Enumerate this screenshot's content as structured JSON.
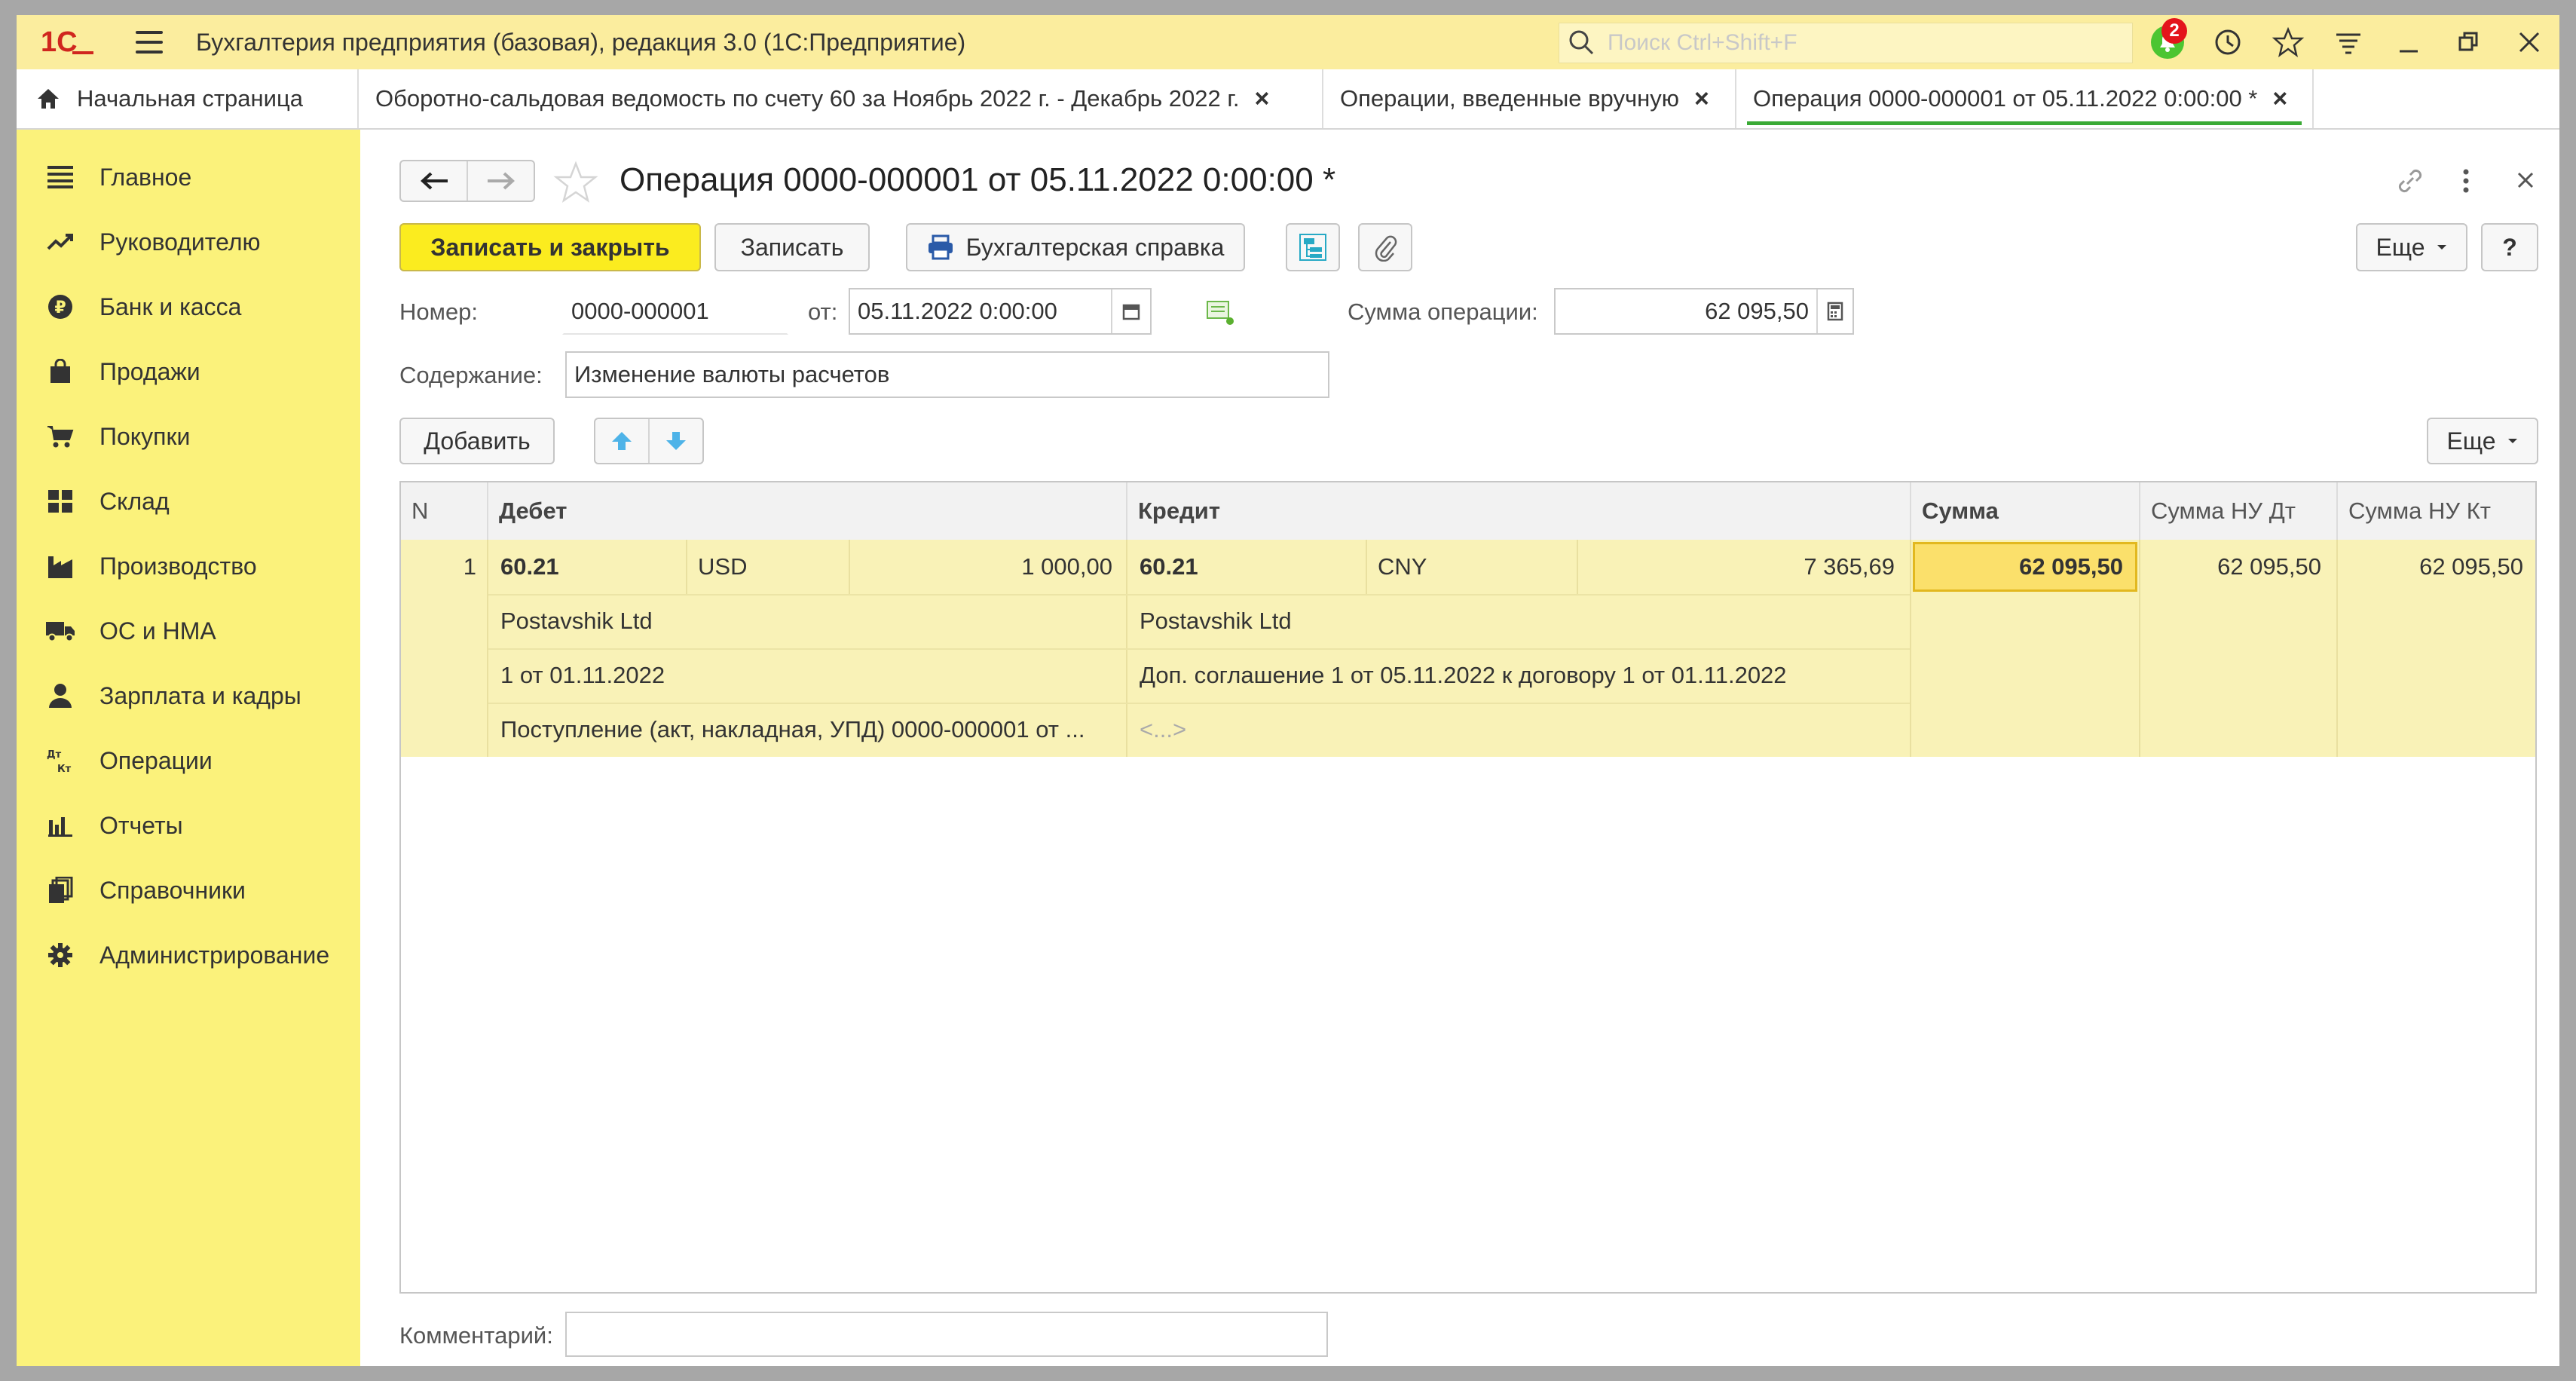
{
  "window": {
    "title": "Бухгалтерия предприятия (базовая), редакция 3.0  (1С:Предприятие)",
    "search_placeholder": "Поиск Ctrl+Shift+F",
    "notification_count": "2"
  },
  "tabs": [
    {
      "label": "Начальная страница",
      "closable": false
    },
    {
      "label": "Оборотно-сальдовая ведомость по счету 60 за Ноябрь 2022 г. - Декабрь 2022 г.",
      "closable": true
    },
    {
      "label": "Операции, введенные вручную",
      "closable": true
    },
    {
      "label": "Операция 0000-000001 от 05.11.2022 0:00:00 *",
      "closable": true,
      "active": true
    }
  ],
  "sidebar": {
    "items": [
      {
        "label": "Главное",
        "icon": "menu-icon"
      },
      {
        "label": "Руководителю",
        "icon": "trend-icon"
      },
      {
        "label": "Банк и касса",
        "icon": "ruble-icon"
      },
      {
        "label": "Продажи",
        "icon": "bag-icon"
      },
      {
        "label": "Покупки",
        "icon": "cart-icon"
      },
      {
        "label": "Склад",
        "icon": "warehouse-icon"
      },
      {
        "label": "Производство",
        "icon": "factory-icon"
      },
      {
        "label": "ОС и НМА",
        "icon": "truck-icon"
      },
      {
        "label": "Зарплата и кадры",
        "icon": "person-icon"
      },
      {
        "label": "Операции",
        "icon": "dt-kt-icon"
      },
      {
        "label": "Отчеты",
        "icon": "bar-chart-icon"
      },
      {
        "label": "Справочники",
        "icon": "books-icon"
      },
      {
        "label": "Администрирование",
        "icon": "gear-icon"
      }
    ]
  },
  "form": {
    "title": "Операция 0000-000001 от 05.11.2022 0:00:00 *",
    "toolbar": {
      "save_close": "Записать и закрыть",
      "save": "Записать",
      "report": "Бухгалтерская справка",
      "more": "Еще",
      "help": "?"
    },
    "number_label": "Номер:",
    "number_value": "0000-000001",
    "date_label": "от:",
    "date_value": "05.11.2022  0:00:00",
    "sum_label": "Сумма операции:",
    "sum_value": "62 095,50",
    "content_label": "Содержание:",
    "content_value": "Изменение валюты расчетов",
    "comment_label": "Комментарий:",
    "comment_value": ""
  },
  "table_toolbar": {
    "add": "Добавить",
    "more": "Еще"
  },
  "table": {
    "columns": [
      "N",
      "Дебет",
      "Кредит",
      "Сумма",
      "Сумма НУ Дт",
      "Сумма НУ Кт"
    ],
    "rows": [
      {
        "n": "1",
        "debit_account": "60.21",
        "debit_currency": "USD",
        "debit_amount": "1 000,00",
        "debit_sub1": "Postavshik Ltd",
        "debit_sub2": "1 от 01.11.2022",
        "debit_sub3": "Поступление (акт, накладная, УПД) 0000-000001 от ...",
        "credit_account": "60.21",
        "credit_currency": "CNY",
        "credit_amount": "7 365,69",
        "credit_sub1": "Postavshik Ltd",
        "credit_sub2": "Доп. соглашение 1 от 05.11.2022 к договору 1 от 01.11.2022",
        "credit_sub3": "<...>",
        "sum": "62 095,50",
        "sum_nu_dt": "62 095,50",
        "sum_nu_kt": "62 095,50"
      }
    ]
  },
  "colors": {
    "sidebar": "#fbf27b",
    "titlebar": "#fbed9e",
    "primary_button": "#fbec1f",
    "row_highlight": "#f9f2b7",
    "active_tab_underline": "#3aaa35"
  }
}
